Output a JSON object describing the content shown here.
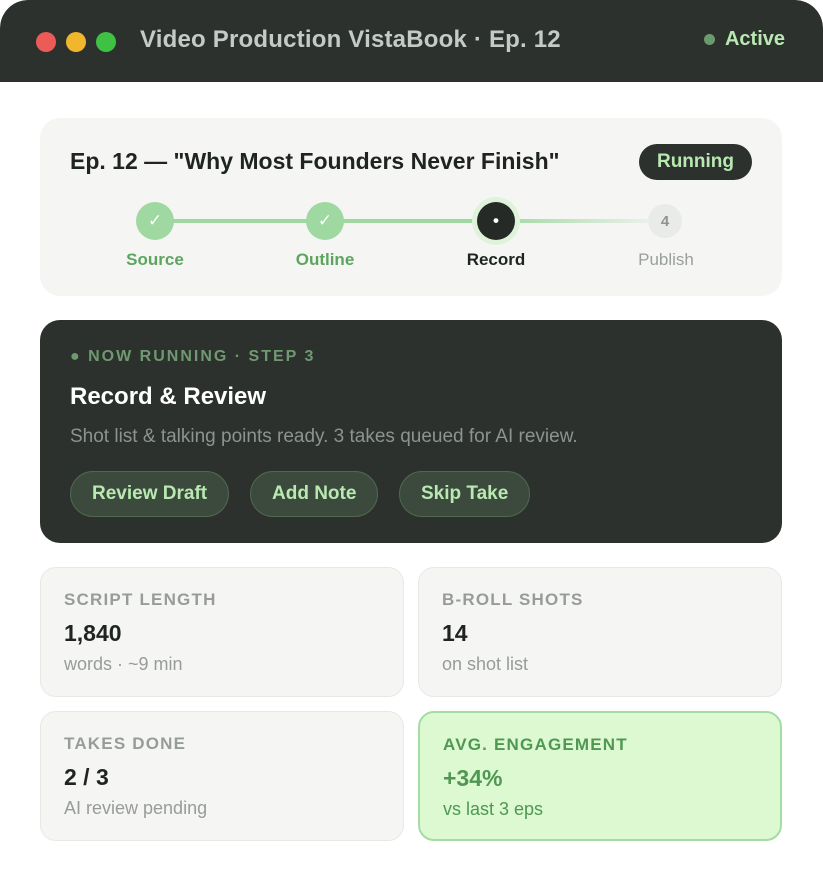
{
  "window": {
    "title": "Video Production VistaBook · Ep. 12",
    "status": "Active"
  },
  "episode": {
    "title": "Ep. 12 — \"Why Most Founders Never Finish\"",
    "status": "Running",
    "steps": [
      {
        "label": "Source",
        "state": "done",
        "marker": "✓"
      },
      {
        "label": "Outline",
        "state": "done",
        "marker": "✓"
      },
      {
        "label": "Record",
        "state": "current",
        "marker": "•"
      },
      {
        "label": "Publish",
        "state": "todo",
        "marker": "4"
      }
    ]
  },
  "now_running": {
    "eyebrow": "● NOW RUNNING · STEP 3",
    "title": "Record & Review",
    "description": "Shot list & talking points ready. 3 takes queued for AI review.",
    "buttons": [
      "Review Draft",
      "Add Note",
      "Skip Take"
    ]
  },
  "stats": [
    {
      "label": "SCRIPT LENGTH",
      "value": "1,840",
      "sub": "words · ~9 min"
    },
    {
      "label": "B-ROLL SHOTS",
      "value": "14",
      "sub": "on shot list"
    },
    {
      "label": "TAKES DONE",
      "value": "2 / 3",
      "sub": "AI review pending"
    },
    {
      "label": "AVG. ENGAGEMENT",
      "value": "+34%",
      "sub": "vs last 3 eps"
    }
  ],
  "colors": {
    "titlebar": "#2c312d",
    "accent_green": "#b8e9b1",
    "done_step": "#9fd8a0",
    "highlight_card": "#dcf9d2"
  }
}
